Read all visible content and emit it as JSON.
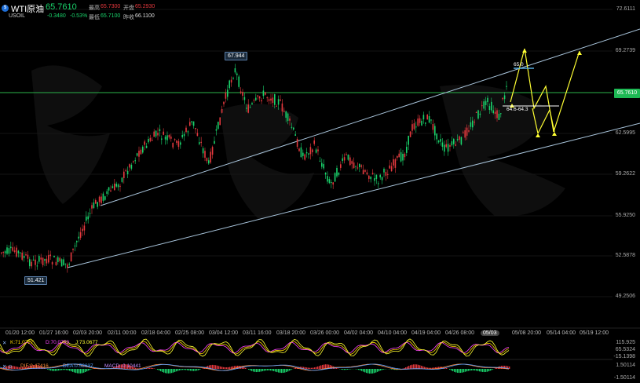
{
  "header": {
    "logo_text": "$",
    "name": "WTI原油",
    "caret": "▾",
    "price": "65.7610",
    "symbol": "USOIL",
    "change": "-0.3480",
    "change_pct": "-0.53%",
    "high_label": "最高",
    "high": "65.7300",
    "open_label": "开盘",
    "open": "65.2930",
    "low_label": "最低",
    "low": "65.7100",
    "prev_label": "昨收",
    "prev": "66.1100"
  },
  "price_axis": [
    "72.6111",
    "69.2739",
    "65.7610",
    "62.5995",
    "59.2622",
    "55.9250",
    "52.5878",
    "49.2506"
  ],
  "current_price": "65.7610",
  "annotations": {
    "high_label": "67.944",
    "low_label": "51.421",
    "target_label": "65.0",
    "range_label": "64.6-64.3"
  },
  "time_axis": [
    "01/20 12:00",
    "01/27 16:00",
    "02/03 20:00",
    "02/11 00:00",
    "02/18 04:00",
    "02/25 08:00",
    "03/04 12:00",
    "03/11 16:00",
    "03/18 20:00",
    "03/26 00:00",
    "04/02 04:00",
    "04/10 04:00",
    "04/19 04:00",
    "04/26 08:00",
    "05/03",
    "05/08 20:00",
    "05/14 04:00",
    "05/19 12:00"
  ],
  "indicators": {
    "kdj": {
      "label": "K:71.0727",
      "d": "D:70.0759",
      "j": "J:73.0677",
      "axis": [
        "115.925",
        "65.5324",
        "-15.1398"
      ]
    },
    "macd": {
      "dif": "DIF:0.47416",
      "dea": "DEA:0.52637",
      "macd": "MACD:-0.10441",
      "axis": [
        "1.50114",
        "-1.50114"
      ]
    }
  },
  "colors": {
    "up": "#19d36b",
    "down": "#e5393e",
    "accent": "#ffff33",
    "channel": "#a9c5dc",
    "hline": "#2bb34a"
  }
}
